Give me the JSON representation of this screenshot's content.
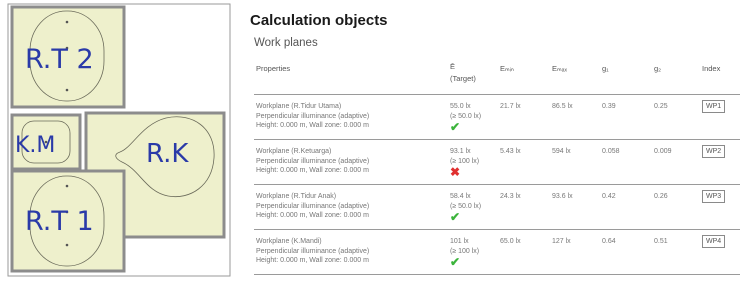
{
  "plan": {
    "rooms": [
      {
        "id": "rt2",
        "label": "R.T 2"
      },
      {
        "id": "km",
        "label": "K.M"
      },
      {
        "id": "rk",
        "label": "R.K"
      },
      {
        "id": "rt1",
        "label": "R.T 1"
      }
    ],
    "colors": {
      "fill": "#eef0cc",
      "wall": "#8c8c8c",
      "label": "#2a3aa8"
    }
  },
  "report": {
    "title": "Calculation objects",
    "subtitle": "Work planes",
    "headers": {
      "properties": "Properties",
      "e": "Ē",
      "e_target": "(Target)",
      "emin": "Eₘᵢₙ",
      "emax": "Eₘₐₓ",
      "g1": "g₁",
      "g2": "g₂",
      "index": "Index"
    },
    "rows": [
      {
        "name": "Workplane (R.Tidur Utama)",
        "type": "Perpendicular illuminance (adaptive)",
        "height": "Height: 0.000 m, Wall zone: 0.000 m",
        "e": "55.0 lx",
        "target": "(≥ 50.0 lx)",
        "emin": "21.7 lx",
        "emax": "86.5 lx",
        "g1": "0.39",
        "g2": "0.25",
        "index": "WP1",
        "status": "pass",
        "status_glyph": "✔"
      },
      {
        "name": "Workplane (R.Ketuarga)",
        "type": "Perpendicular illuminance (adaptive)",
        "height": "Height: 0.000 m, Wall zone: 0.000 m",
        "e": "93.1 lx",
        "target": "(≥ 100 lx)",
        "emin": "5.43 lx",
        "emax": "594 lx",
        "g1": "0.058",
        "g2": "0.009",
        "index": "WP2",
        "status": "fail",
        "status_glyph": "✖"
      },
      {
        "name": "Workplane (R.Tidur Anak)",
        "type": "Perpendicular illuminance (adaptive)",
        "height": "Height: 0.000 m, Wall zone: 0.000 m",
        "e": "58.4 lx",
        "target": "(≥ 50.0 lx)",
        "emin": "24.3 lx",
        "emax": "93.6 lx",
        "g1": "0.42",
        "g2": "0.26",
        "index": "WP3",
        "status": "pass",
        "status_glyph": "✔"
      },
      {
        "name": "Workplane (K.Mandi)",
        "type": "Perpendicular illuminance (adaptive)",
        "height": "Height: 0.000 m, Wall zone: 0.000 m",
        "e": "101 lx",
        "target": "(≥ 100 lx)",
        "emin": "65.0 lx",
        "emax": "127 lx",
        "g1": "0.64",
        "g2": "0.51",
        "index": "WP4",
        "status": "pass",
        "status_glyph": "✔"
      }
    ],
    "colors": {
      "pass": "#3cb43c",
      "fail": "#e03030",
      "rule": "#9a9a9a"
    }
  }
}
